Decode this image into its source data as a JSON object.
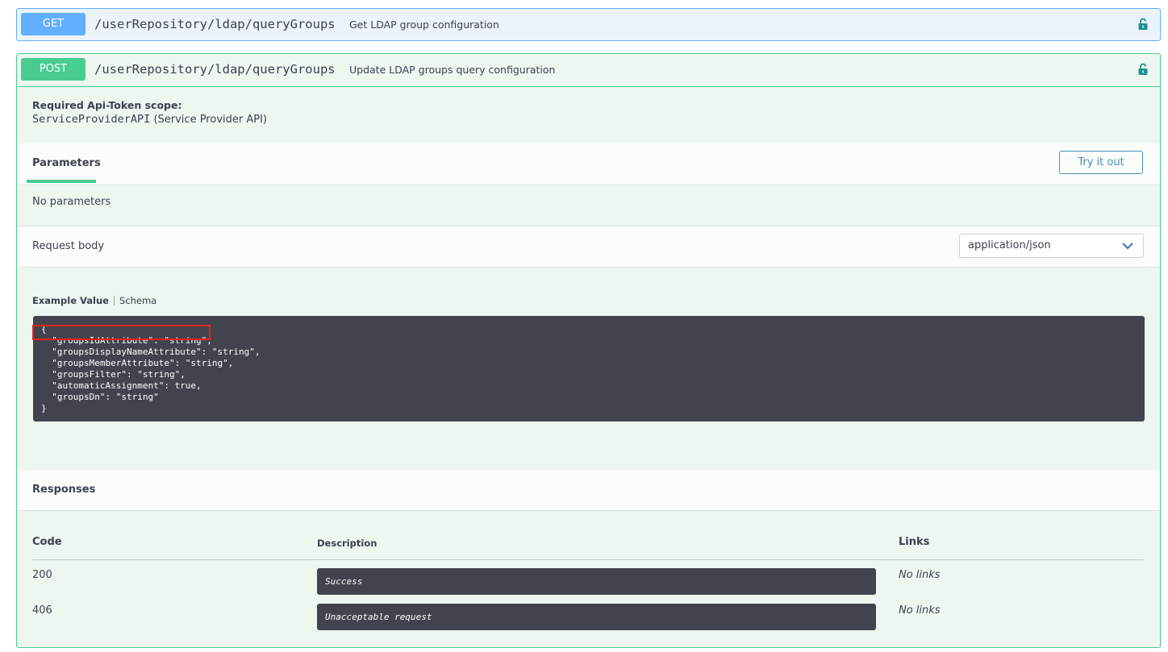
{
  "get_op": {
    "method": "GET",
    "path": "/userRepository/ldap/queryGroups",
    "description": "Get LDAP group configuration",
    "lock_icon": "unlocked-padlock-icon"
  },
  "post_op": {
    "method": "POST",
    "path": "/userRepository/ldap/queryGroups",
    "description": "Update LDAP groups query configuration",
    "lock_icon": "unlocked-padlock-icon",
    "scope_label": "Required Api-Token scope:",
    "scope_code": "ServiceProviderAPI",
    "scope_desc": " (Service Provider API)",
    "parameters_tab": "Parameters",
    "try_button": "Try it out",
    "no_parameters": "No parameters",
    "request_body_label": "Request body",
    "content_type": "application/json",
    "example_tab": "Example Value",
    "schema_tab": "Schema",
    "example_code": "{\n  \"groupsIdAttribute\": \"string\",\n  \"groupsDisplayNameAttribute\": \"string\",\n  \"groupsMemberAttribute\": \"string\",\n  \"groupsFilter\": \"string\",\n  \"automaticAssignment\": true,\n  \"groupsDn\": \"string\"\n}",
    "responses_title": "Responses",
    "responses_table": {
      "headers": {
        "code": "Code",
        "description": "Description",
        "links": "Links"
      },
      "rows": [
        {
          "code": "200",
          "description": "Success",
          "links": "No links"
        },
        {
          "code": "406",
          "description": "Unacceptable request",
          "links": "No links"
        }
      ]
    }
  },
  "colors": {
    "get": "#61affe",
    "post": "#49cc90",
    "highlight": "#e8221b",
    "code_bg": "#41444e"
  }
}
